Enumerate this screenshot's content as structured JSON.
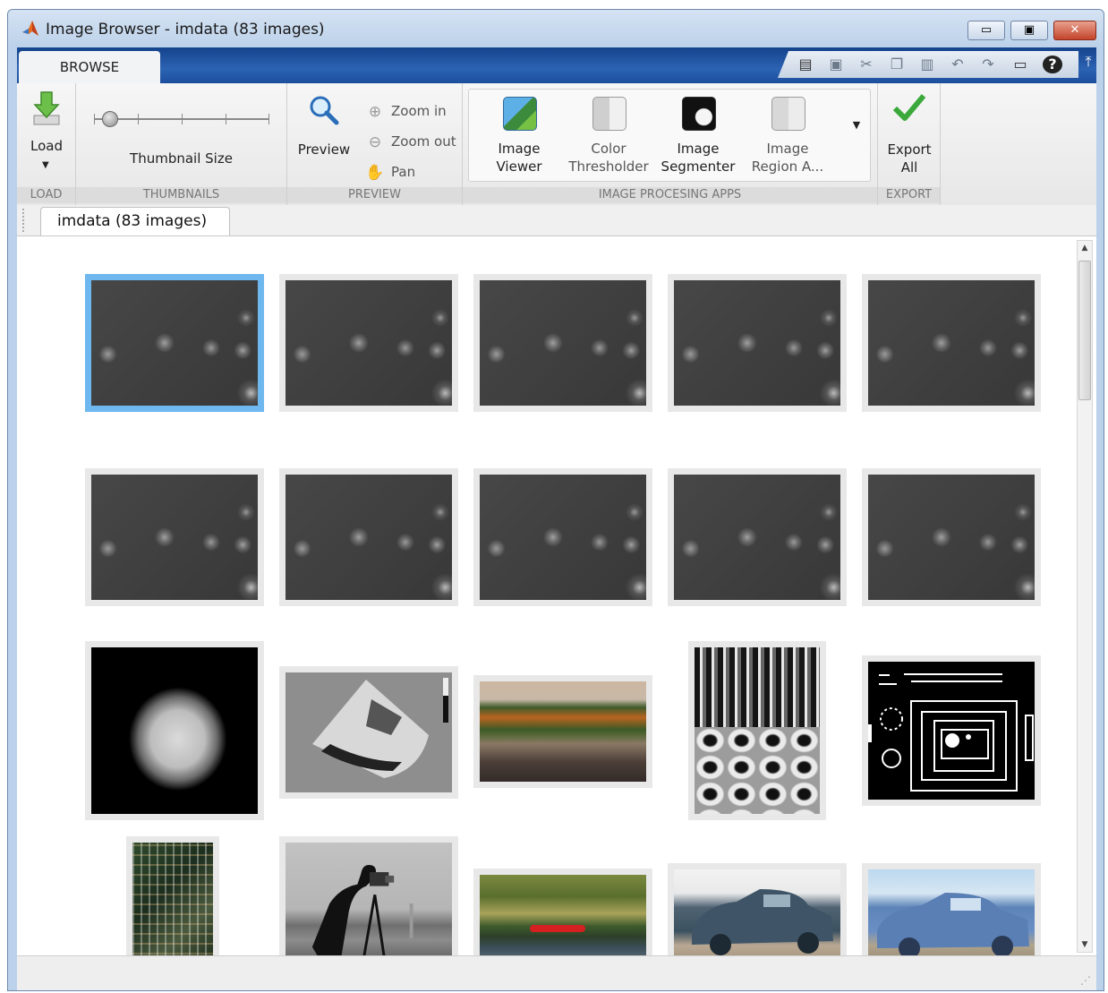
{
  "window": {
    "title": "Image Browser - imdata (83 images)",
    "controls": {
      "minimize": "▭",
      "maximize": "▣",
      "close": "✕"
    }
  },
  "ribbon": {
    "active_tab": "BROWSE",
    "quick_access_icons": [
      "new-icon",
      "save-icon",
      "cut-icon",
      "copy-icon",
      "paste-icon",
      "undo-icon",
      "redo-icon",
      "window-icon",
      "help-icon"
    ],
    "sections": {
      "load": {
        "label": "LOAD",
        "button": "Load"
      },
      "thumbnails": {
        "label": "THUMBNAILS",
        "slider_label": "Thumbnail Size",
        "slider_value": 0.09
      },
      "preview": {
        "label": "PREVIEW",
        "button": "Preview",
        "zoom_in": "Zoom in",
        "zoom_out": "Zoom out",
        "pan": "Pan"
      },
      "apps": {
        "label": "IMAGE PROCESING APPS",
        "items": [
          {
            "line1": "Image",
            "line2": "Viewer"
          },
          {
            "line1": "Color",
            "line2": "Thresholder"
          },
          {
            "line1": "Image",
            "line2": "Segmenter"
          },
          {
            "line1": "Image",
            "line2": "Region A..."
          }
        ]
      },
      "export": {
        "label": "EXPORT",
        "line1": "Export",
        "line2": "All"
      }
    }
  },
  "document_tab": {
    "label": "imdata (83 images)"
  },
  "colors": {
    "accent_blue": "#1c4e9d",
    "selection": "#6fb8ef",
    "export_check": "#3aa83a"
  }
}
